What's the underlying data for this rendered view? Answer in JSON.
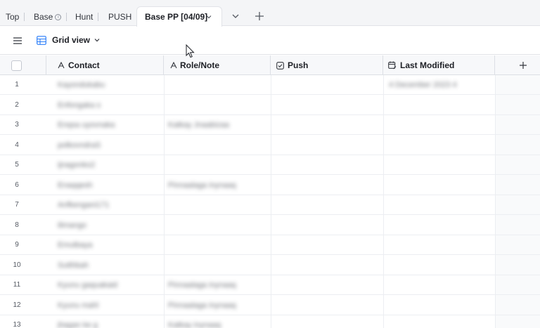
{
  "tabs": [
    {
      "label": "Top"
    },
    {
      "label": "Base"
    },
    {
      "label": "Hunt"
    },
    {
      "label": "PUSH"
    }
  ],
  "active_tab": {
    "label": "Base PP [04/09]"
  },
  "icons": {
    "info": "info-icon",
    "chevron": "chevron-down-icon",
    "add": "plus-icon",
    "menu": "hamburger-menu-icon",
    "grid": "grid-view-icon",
    "text_field": "text-field-icon",
    "checkbox_field": "checkbox-field-icon",
    "calendar_field": "calendar-edit-icon"
  },
  "info_glyph": "i",
  "viewbar": {
    "view_label": "Grid view"
  },
  "columns": [
    {
      "label": "Contact"
    },
    {
      "label": "Role/Note"
    },
    {
      "label": "Push"
    },
    {
      "label": "Last Modified"
    }
  ],
  "colors": {
    "tabbar_bg": "#f4f5f7",
    "header_bg": "#f7f8fa",
    "border": "#dcdfe5",
    "text": "#1d1f25"
  },
  "rows": [
    {
      "n": "1",
      "contact": "Kayondukabu",
      "role": "",
      "modified": "4 December 2023 4"
    },
    {
      "n": "2",
      "contact": "Enfongaka s",
      "role": "",
      "modified": ""
    },
    {
      "n": "3",
      "contact": "Enqsa uyovnaka",
      "role": "Katkay Jnaabizaa",
      "modified": ""
    },
    {
      "n": "4",
      "contact": "polkovndraS",
      "role": "",
      "modified": ""
    },
    {
      "n": "5",
      "contact": "ijnagonko2",
      "role": "",
      "modified": ""
    },
    {
      "n": "6",
      "contact": "Enaqqesh",
      "role": "Pinnaalaga inynaaq",
      "modified": ""
    },
    {
      "n": "7",
      "contact": "Anfkengani171",
      "role": "",
      "modified": ""
    },
    {
      "n": "8",
      "contact": "ilimango",
      "role": "",
      "modified": ""
    },
    {
      "n": "9",
      "contact": "Emutbaya",
      "role": "",
      "modified": ""
    },
    {
      "n": "10",
      "contact": "Sutthbah",
      "role": "",
      "modified": ""
    },
    {
      "n": "11",
      "contact": "Kyunu gaquakaid",
      "role": "Pinnaalaga inynaaq",
      "modified": ""
    },
    {
      "n": "12",
      "contact": "Kyunu mahl",
      "role": "Pinnaalaga inynaaq",
      "modified": ""
    },
    {
      "n": "13",
      "contact": "jhagan ke g",
      "role": "Katkay inynaaq",
      "modified": ""
    }
  ]
}
